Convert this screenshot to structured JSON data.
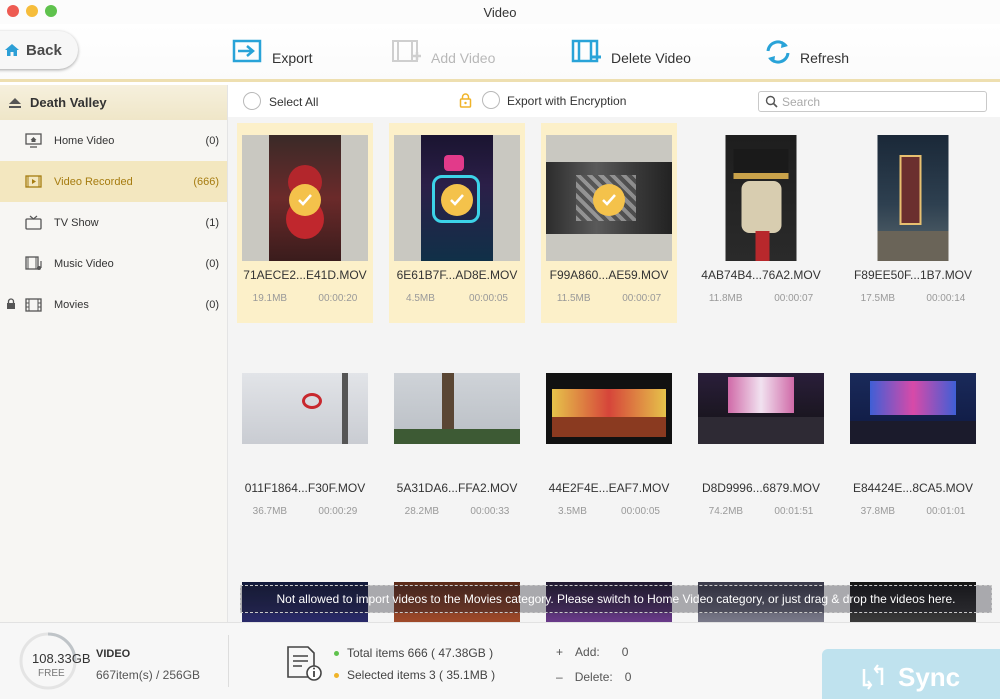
{
  "window": {
    "title": "Video"
  },
  "toolbar": {
    "back": "Back",
    "export": "Export",
    "add_video": "Add Video",
    "delete_video": "Delete Video",
    "refresh": "Refresh"
  },
  "sidebar": {
    "device": "Death Valley",
    "categories": [
      {
        "label": "Home Video",
        "count": "(0)"
      },
      {
        "label": "Video Recorded",
        "count": "(666)"
      },
      {
        "label": "TV Show",
        "count": "(1)"
      },
      {
        "label": "Music Video",
        "count": "(0)"
      },
      {
        "label": "Movies",
        "count": "(0)"
      }
    ]
  },
  "content": {
    "select_all": "Select All",
    "export_encryption": "Export with Encryption",
    "search_placeholder": "Search"
  },
  "videos": [
    {
      "name": "71AECE2...E41D.MOV",
      "size": "19.1MB",
      "duration": "00:00:20"
    },
    {
      "name": "6E61B7F...AD8E.MOV",
      "size": "4.5MB",
      "duration": "00:00:05"
    },
    {
      "name": "F99A860...AE59.MOV",
      "size": "11.5MB",
      "duration": "00:00:07"
    },
    {
      "name": "4AB74B4...76A2.MOV",
      "size": "11.8MB",
      "duration": "00:00:07"
    },
    {
      "name": "F89EE50F...1B7.MOV",
      "size": "17.5MB",
      "duration": "00:00:14"
    },
    {
      "name": "011F1864...F30F.MOV",
      "size": "36.7MB",
      "duration": "00:00:29"
    },
    {
      "name": "5A31DA6...FFA2.MOV",
      "size": "28.2MB",
      "duration": "00:00:33"
    },
    {
      "name": "44E2F4E...EAF7.MOV",
      "size": "3.5MB",
      "duration": "00:00:05"
    },
    {
      "name": "D8D9996...6879.MOV",
      "size": "74.2MB",
      "duration": "00:01:51"
    },
    {
      "name": "E84424E...8CA5.MOV",
      "size": "37.8MB",
      "duration": "00:01:01"
    }
  ],
  "notice": "Not allowed to import videos to the Movies category. Please switch to Home Video category, or just drag & drop the videos here.",
  "bottom": {
    "free": "108.33GB",
    "free_label": "FREE",
    "media_type": "VIDEO",
    "media_count": "667item(s) / 256GB",
    "total_items": "Total items 666 ( 47.38GB )",
    "selected_items": "Selected items 3 ( 35.1MB )",
    "add_label": "Add:",
    "add_value": "0",
    "delete_label": "Delete:",
    "delete_value": "0",
    "sync": "Sync"
  },
  "colors": {
    "accent": "#f4c24b",
    "selected_tile": "#fcf0c9",
    "active_category": "#f3e7bf",
    "sync_button": "#bfe2ee",
    "toolbar_icon": "#29a3d8"
  }
}
